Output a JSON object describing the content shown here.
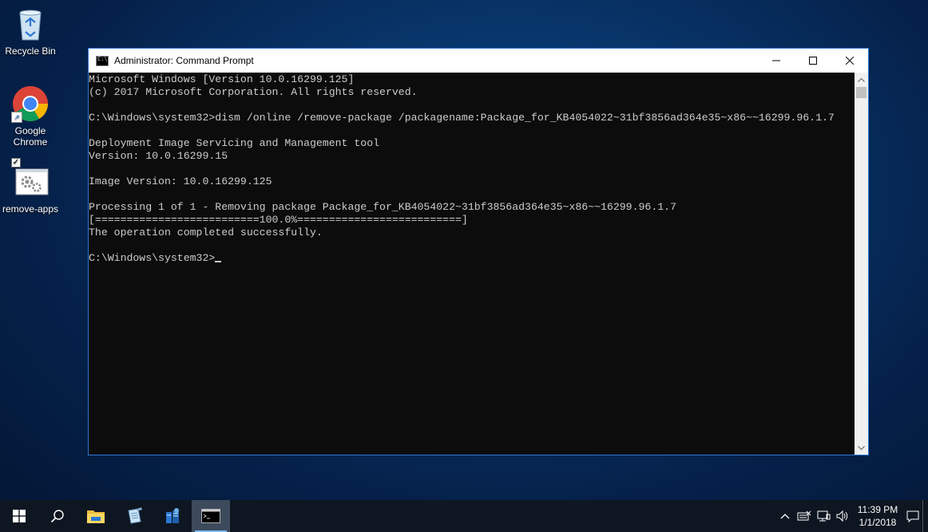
{
  "desktop": {
    "icons": [
      {
        "label": "Recycle Bin",
        "icon": "recycle-bin-icon"
      },
      {
        "label": "Google Chrome",
        "icon": "chrome-icon"
      },
      {
        "label": "remove-apps",
        "icon": "settings-file-icon"
      }
    ]
  },
  "window": {
    "title": "Administrator: Command Prompt",
    "minimize": "—",
    "maximize": "☐",
    "close": "✕"
  },
  "console": {
    "lines": [
      "Microsoft Windows [Version 10.0.16299.125]",
      "(c) 2017 Microsoft Corporation. All rights reserved.",
      "",
      "C:\\Windows\\system32>dism /online /remove-package /packagename:Package_for_KB4054022~31bf3856ad364e35~x86~~16299.96.1.7",
      "",
      "Deployment Image Servicing and Management tool",
      "Version: 10.0.16299.15",
      "",
      "Image Version: 10.0.16299.125",
      "",
      "Processing 1 of 1 - Removing package Package_for_KB4054022~31bf3856ad364e35~x86~~16299.96.1.7",
      "[==========================100.0%==========================]",
      "The operation completed successfully.",
      ""
    ],
    "prompt": "C:\\Windows\\system32>"
  },
  "taskbar": {
    "apps": [
      "start-icon",
      "search-icon",
      "file-explorer-icon",
      "notepad-icon",
      "server-manager-icon",
      "command-prompt-icon"
    ],
    "time": "11:39 PM",
    "date": "1/1/2018"
  },
  "colors": {
    "console_bg": "#0c0c0c",
    "console_fg": "#cccccc",
    "accent": "#2b78d4",
    "taskbar": "#0e1621"
  }
}
